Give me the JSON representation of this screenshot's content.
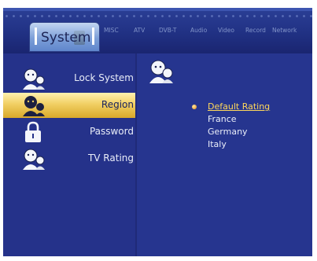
{
  "header": {
    "system_label": "System",
    "tabs": [
      {
        "id": "misc",
        "label": "MISC"
      },
      {
        "id": "atv",
        "label": "ATV"
      },
      {
        "id": "dvbt",
        "label": "DVB-T"
      },
      {
        "id": "audio",
        "label": "Audio"
      },
      {
        "id": "video",
        "label": "Video"
      },
      {
        "id": "record",
        "label": "Record"
      },
      {
        "id": "network",
        "label": "Network"
      }
    ]
  },
  "menu": {
    "items": [
      {
        "label": "Lock System",
        "icon": "users-icon"
      },
      {
        "label": "Region",
        "icon": "users-icon",
        "selected": true
      },
      {
        "label": "Password",
        "icon": "padlock-icon"
      },
      {
        "label": "TV Rating",
        "icon": "users-icon"
      }
    ]
  },
  "content": {
    "icon": "users-icon",
    "options": [
      {
        "label": "Default Rating",
        "selected": true
      },
      {
        "label": "France"
      },
      {
        "label": "Germany"
      },
      {
        "label": "Italy"
      }
    ]
  },
  "colors": {
    "background": "#1f2a78",
    "menu_bg": "#25328a",
    "selection": "#f1cf63",
    "selected_option": "#ffd85a",
    "text": "#e9edf8"
  }
}
